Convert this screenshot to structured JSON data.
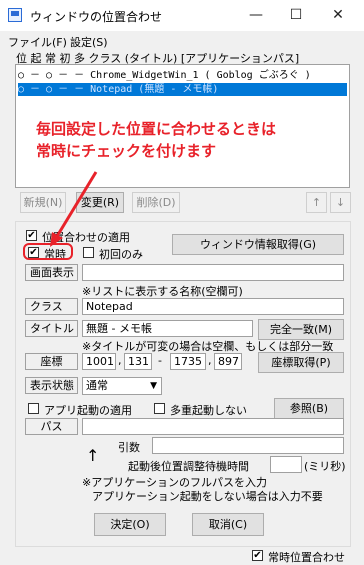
{
  "window": {
    "title": "ウィンドウの位置合わせ",
    "minimize": "—",
    "maximize": "☐",
    "close": "✕"
  },
  "menu": {
    "file": "ファイル(F)",
    "settings": "設定(S)"
  },
  "list": {
    "header": "位 起 常 初 多 クラス (タイトル) [アプリケーションパス]",
    "rows": [
      "○ － ○ － － Chrome_WidgetWin_1 ( Goblog ごぶろぐ )",
      "○ － ○ － － Notepad (無題 - メモ帳)"
    ]
  },
  "annotation": {
    "line1": "毎回設定した位置に合わせるときは",
    "line2": "常時にチェックを付けます"
  },
  "buttons": {
    "new": "新規(N)",
    "edit": "変更(R)",
    "delete": "削除(D)",
    "up": "↑",
    "down": "↓",
    "window_info": "ウィンドウ情報取得(G)",
    "exact_match": "完全一致(M)",
    "get_coords": "座標取得(P)",
    "browse": "参照(B)",
    "ok": "決定(O)",
    "cancel": "取消(C)"
  },
  "form": {
    "apply_position": "位置合わせの適用",
    "always": "常時",
    "first_only": "初回のみ",
    "display_name_label": "画面表示",
    "display_name_value": "",
    "display_name_note": "※リストに表示する名称(空欄可)",
    "class_label": "クラス",
    "class_value": "Notepad",
    "title_label": "タイトル",
    "title_value": "無題 - メモ帳",
    "title_note": "※タイトルが可変の場合は空欄、もしくは部分一致",
    "coords_label": "座標",
    "x1": "1001",
    "y1": "131",
    "x2": "1735",
    "y2": "897",
    "comma": ",",
    "dash": "-",
    "display_state_label": "表示状態",
    "display_state_value": "通常",
    "app_launch": "アプリ起動の適用",
    "multi_launch": "多重起動しない",
    "path_label": "パス",
    "path_value": "",
    "args_label": "引数",
    "args_value": "",
    "wait_label": "起動後位置調整待機時間",
    "wait_value": "",
    "wait_unit": "(ミリ秒)",
    "path_note1": "※アプリケーションのフルパスを入力",
    "path_note2": "アプリケーション起動をしない場合は入力不要",
    "up_arrow_glyph": "↑"
  },
  "footer": {
    "always_position": "常時位置合わせ"
  },
  "colors": {
    "accent": "#0078d7",
    "annotation": "#e8222a"
  }
}
